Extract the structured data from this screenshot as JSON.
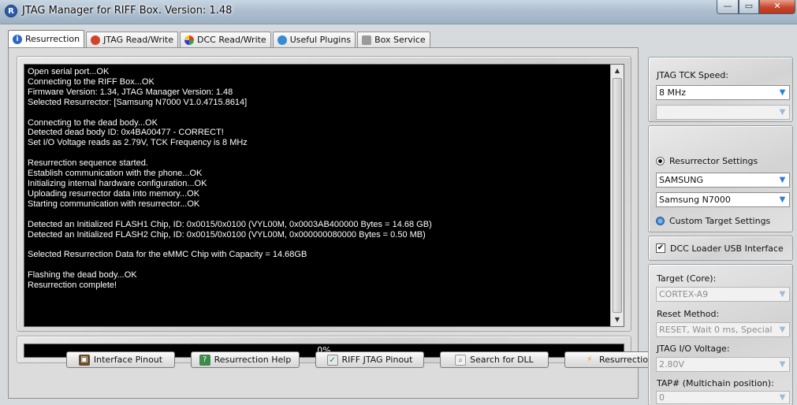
{
  "window": {
    "title": "JTAG Manager for RIFF Box. Version: 1.48",
    "app_icon_letter": "R",
    "min_glyph": "—",
    "max_glyph": "▭",
    "close_glyph": "✕"
  },
  "tabs": [
    {
      "label": "Resurrection",
      "active": true
    },
    {
      "label": "JTAG Read/Write"
    },
    {
      "label": "DCC Read/Write"
    },
    {
      "label": "Useful Plugins"
    },
    {
      "label": "Box Service"
    }
  ],
  "log": {
    "text": "Open serial port...OK\nConnecting to the RIFF Box...OK\nFirmware Version: 1.34, JTAG Manager Version: 1.48\nSelected Resurrector: [Samsung N7000 V1.0.4715.8614]\n\nConnecting to the dead body...OK\nDetected dead body ID: 0x4BA00477 - CORRECT!\nSet I/O Voltage reads as 2.79V, TCK Frequency is 8 MHz\n\nResurrection sequence started.\nEstablish communication with the phone...OK\nInitializing internal hardware configuration...OK\nUploading resurrector data into memory...OK\nStarting communication with resurrector...OK\n\nDetected an Initialized FLASH1 Chip, ID: 0x0015/0x0100 (VYL00M, 0x0003AB400000 Bytes = 14.68 GB)\nDetected an Initialized FLASH2 Chip, ID: 0x0015/0x0100 (VYL00M, 0x000000080000 Bytes = 0.50 MB)\n\nSelected Resurrection Data for the eMMC Chip with Capacity = 14.68GB\n\nFlashing the dead body...OK\nResurrection complete!"
  },
  "progress": {
    "value": 0,
    "label": "0%"
  },
  "buttons": {
    "interface_pinout": "Interface Pinout",
    "resurrection_help": "Resurrection Help",
    "riff_jtag_pinout": "RIFF JTAG Pinout",
    "search_for_dll": "Search for DLL",
    "resurrection": "Resurrection"
  },
  "sidebar": {
    "tck_speed_label": "JTAG TCK Speed:",
    "tck_speed_value": "8 MHz",
    "tck_secondary_value": "",
    "resurrector_settings_label": "Resurrector Settings",
    "manufacturer_value": "SAMSUNG",
    "model_value": "Samsung N7000",
    "custom_target_label": "Custom Target Settings",
    "dcc_loader_label": "DCC Loader USB Interface",
    "target_core_label": "Target (Core):",
    "target_core_value": "CORTEX-A9",
    "reset_method_label": "Reset Method:",
    "reset_method_value": "RESET, Wait 0 ms, Special",
    "io_voltage_label": "JTAG I/O Voltage:",
    "io_voltage_value": "2.80V",
    "tap_label": "TAP# (Multichain position):",
    "tap_value": "0"
  },
  "colors": {
    "log_background": "#000000",
    "log_text": "#ffffff",
    "accent_drop_arrow": "#2c7fd6"
  }
}
